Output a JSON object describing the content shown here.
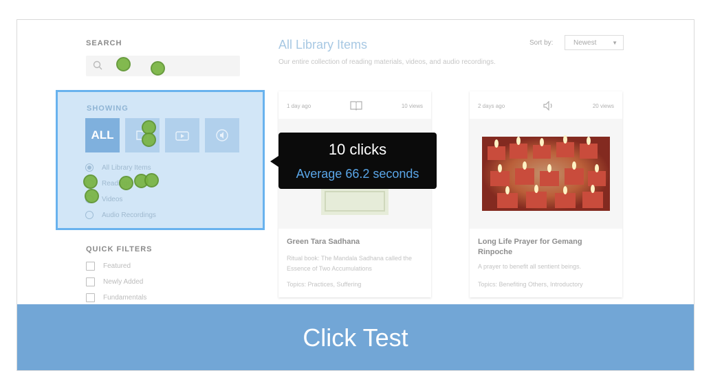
{
  "sidebar": {
    "search_label": "SEARCH",
    "showing_label": "SHOWING",
    "type_buttons": {
      "all_label": "ALL"
    },
    "radio_options": [
      "All Library Items",
      "Readings",
      "Videos",
      "Audio Recordings"
    ],
    "quick_filters_label": "QUICK FILTERS",
    "quick_filters": [
      "Featured",
      "Newly Added",
      "Fundamentals"
    ]
  },
  "main": {
    "title": "All Library Items",
    "subtitle": "Our entire collection of reading materials, videos, and audio recordings.",
    "sort_label": "Sort by:",
    "sort_value": "Newest",
    "cards": [
      {
        "time": "1 day ago",
        "views": "10 views",
        "media_icon": "book-icon",
        "title": "Green Tara Sadhana",
        "desc": "Ritual book: The Mandala Sadhana called the Essence of Two Accumulations",
        "topics": "Topics: Practices, Suffering"
      },
      {
        "time": "2 days ago",
        "views": "20 views",
        "media_icon": "speaker-icon",
        "title": "Long Life Prayer for Gemang Rinpoche",
        "desc": "A prayer to benefit all sentient beings.",
        "topics": "Topics: Benefiting Others, Introductory"
      }
    ]
  },
  "tooltip": {
    "clicks": "10 clicks",
    "average": "Average 66.2 seconds"
  },
  "banner": {
    "text": "Click Test"
  },
  "colors": {
    "banner": "#72a6d6",
    "highlight_border": "#68b2ee",
    "click_dot": "#79b442",
    "tooltip_accent": "#5aa6e8"
  }
}
